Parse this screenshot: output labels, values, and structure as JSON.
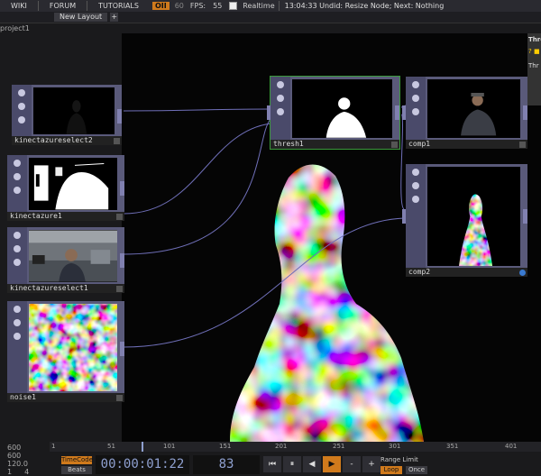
{
  "topbar": {
    "menu": [
      "WIKI",
      "FORUM",
      "TUTORIALS"
    ],
    "op_badge": "OII",
    "fps_target": "60",
    "fps_label": "FPS:",
    "fps_value": "55",
    "realtime_label": "Realtime",
    "status": "13:04:33 Undid: Resize Node; Next: Nothing"
  },
  "tabbar": {
    "tab": "New Layout",
    "add": "+"
  },
  "path": "project1",
  "nodes": {
    "kinectazureselect2": "kinectazureselect2",
    "kinectazure1": "kinectazure1",
    "kinectazureselect1": "kinectazureselect1",
    "noise1": "noise1",
    "thresh1": "thresh1",
    "comp1": "comp1",
    "comp2": "comp2"
  },
  "rightpanel": {
    "title": "Thre",
    "sub": "Thr"
  },
  "timeline": {
    "left_values": [
      "600",
      "600",
      "120.0",
      "1",
      "4"
    ],
    "ruler": [
      "1",
      "51",
      "101",
      "151",
      "201",
      "251",
      "301",
      "351",
      "401"
    ],
    "timecode_btn": "TimeCode",
    "beats_btn": "Beats",
    "timecode": "00:00:01:22",
    "frame": "83",
    "transport": [
      "⏮",
      "⏸",
      "◀",
      "▶",
      "-",
      "+"
    ],
    "range_label": "Range Limit",
    "loop": "Loop",
    "once": "Once"
  },
  "colors": {
    "accent": "#d07a1c",
    "node": "#5a5a7a",
    "wire": "#6f6fb8",
    "selected": "#3a9a3a"
  }
}
